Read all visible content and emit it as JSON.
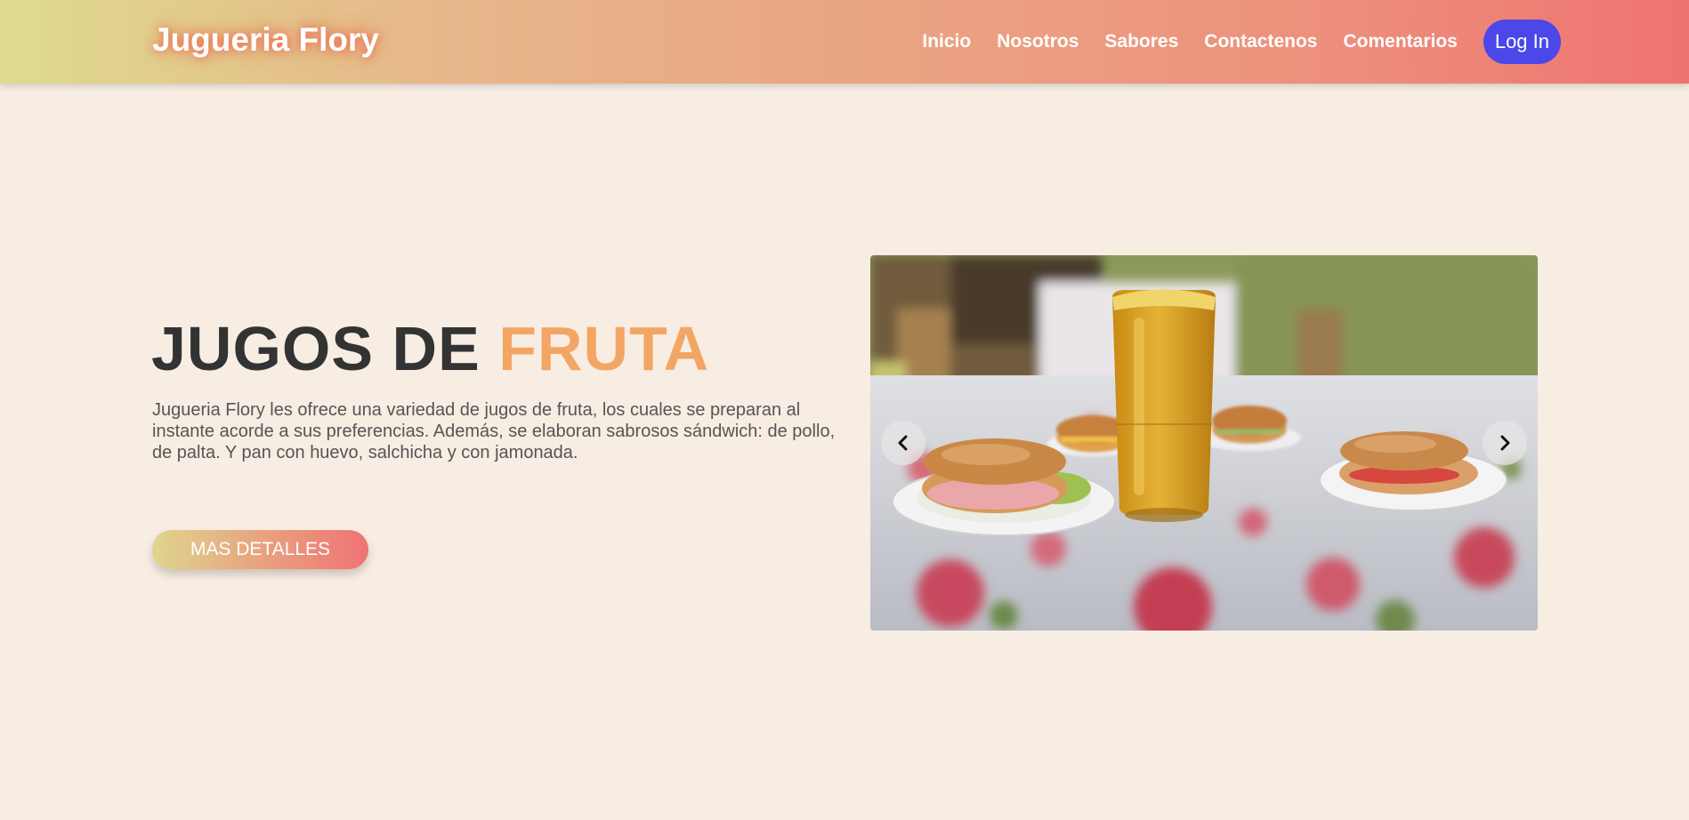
{
  "navbar": {
    "brand": "Jugueria Flory",
    "links": [
      "Inicio",
      "Nosotros",
      "Sabores",
      "Contactenos",
      "Comentarios"
    ],
    "login_label": "Log In"
  },
  "hero": {
    "title_main": "JUGOS DE ",
    "title_accent": "FRUTA",
    "description": "Jugueria Flory les ofrece una variedad de jugos de fruta, los cuales se preparan al instante acorde a sus preferencias. Además, se elaboran sabrosos sándwich: de pollo, de palta. Y pan con huevo, salchicha y con jamonada.",
    "cta_label": "MAS DETALLES"
  },
  "carousel": {
    "prev_icon": "chevron-left-icon",
    "next_icon": "chevron-right-icon"
  },
  "colors": {
    "background": "#f7ede3",
    "accent": "#f3a663",
    "login_button": "#4b47e8",
    "nav_gradient": [
      "#dfdb8e",
      "#ee7370"
    ]
  }
}
